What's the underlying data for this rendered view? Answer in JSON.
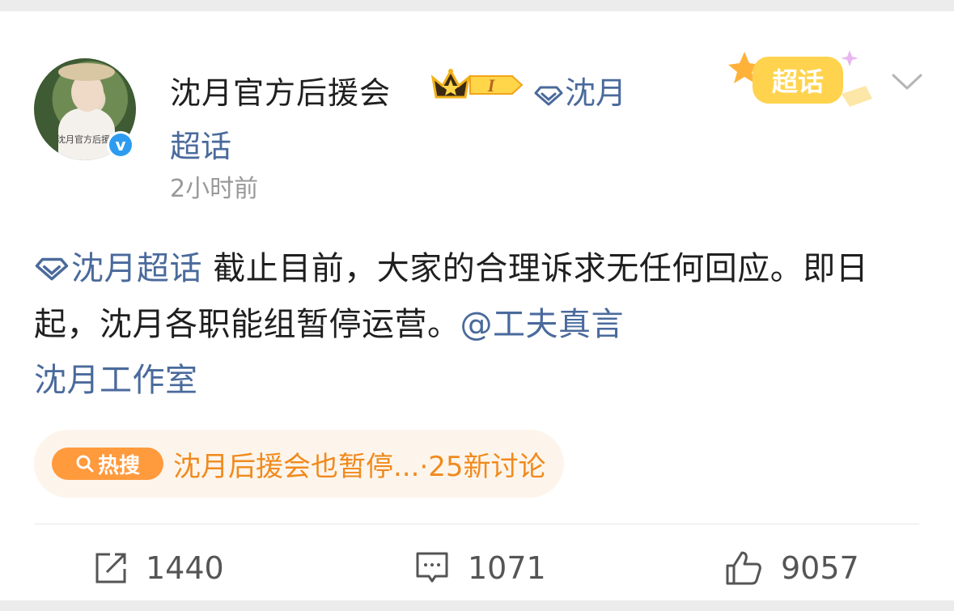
{
  "post": {
    "author_name": "沈月官方后援会",
    "author_topic_line1": "沈月",
    "author_topic_line2": "超话",
    "timestamp": "2小时前",
    "avatar_watermark": "沈月官方后援",
    "level_badge": "I",
    "badge_label": "超话",
    "content": {
      "topic_link": "沈月超话",
      "text_part1": " 截止目前，大家的合理诉求无任何回应。即日起，沈月各职能组暂停运营。",
      "mention1": "@工夫真言",
      "mention2": "沈月工作室"
    },
    "hot_search": {
      "badge": "热搜",
      "text": "沈月后援会也暂停...",
      "suffix": "·25新讨论"
    },
    "actions": {
      "repost_count": "1440",
      "comment_count": "1071",
      "like_count": "9057"
    }
  },
  "colors": {
    "link": "#4a6a9c",
    "hot_orange": "#f08a1d",
    "hot_badge": "#ff9a3d",
    "verified_blue": "#2d9cf0"
  }
}
